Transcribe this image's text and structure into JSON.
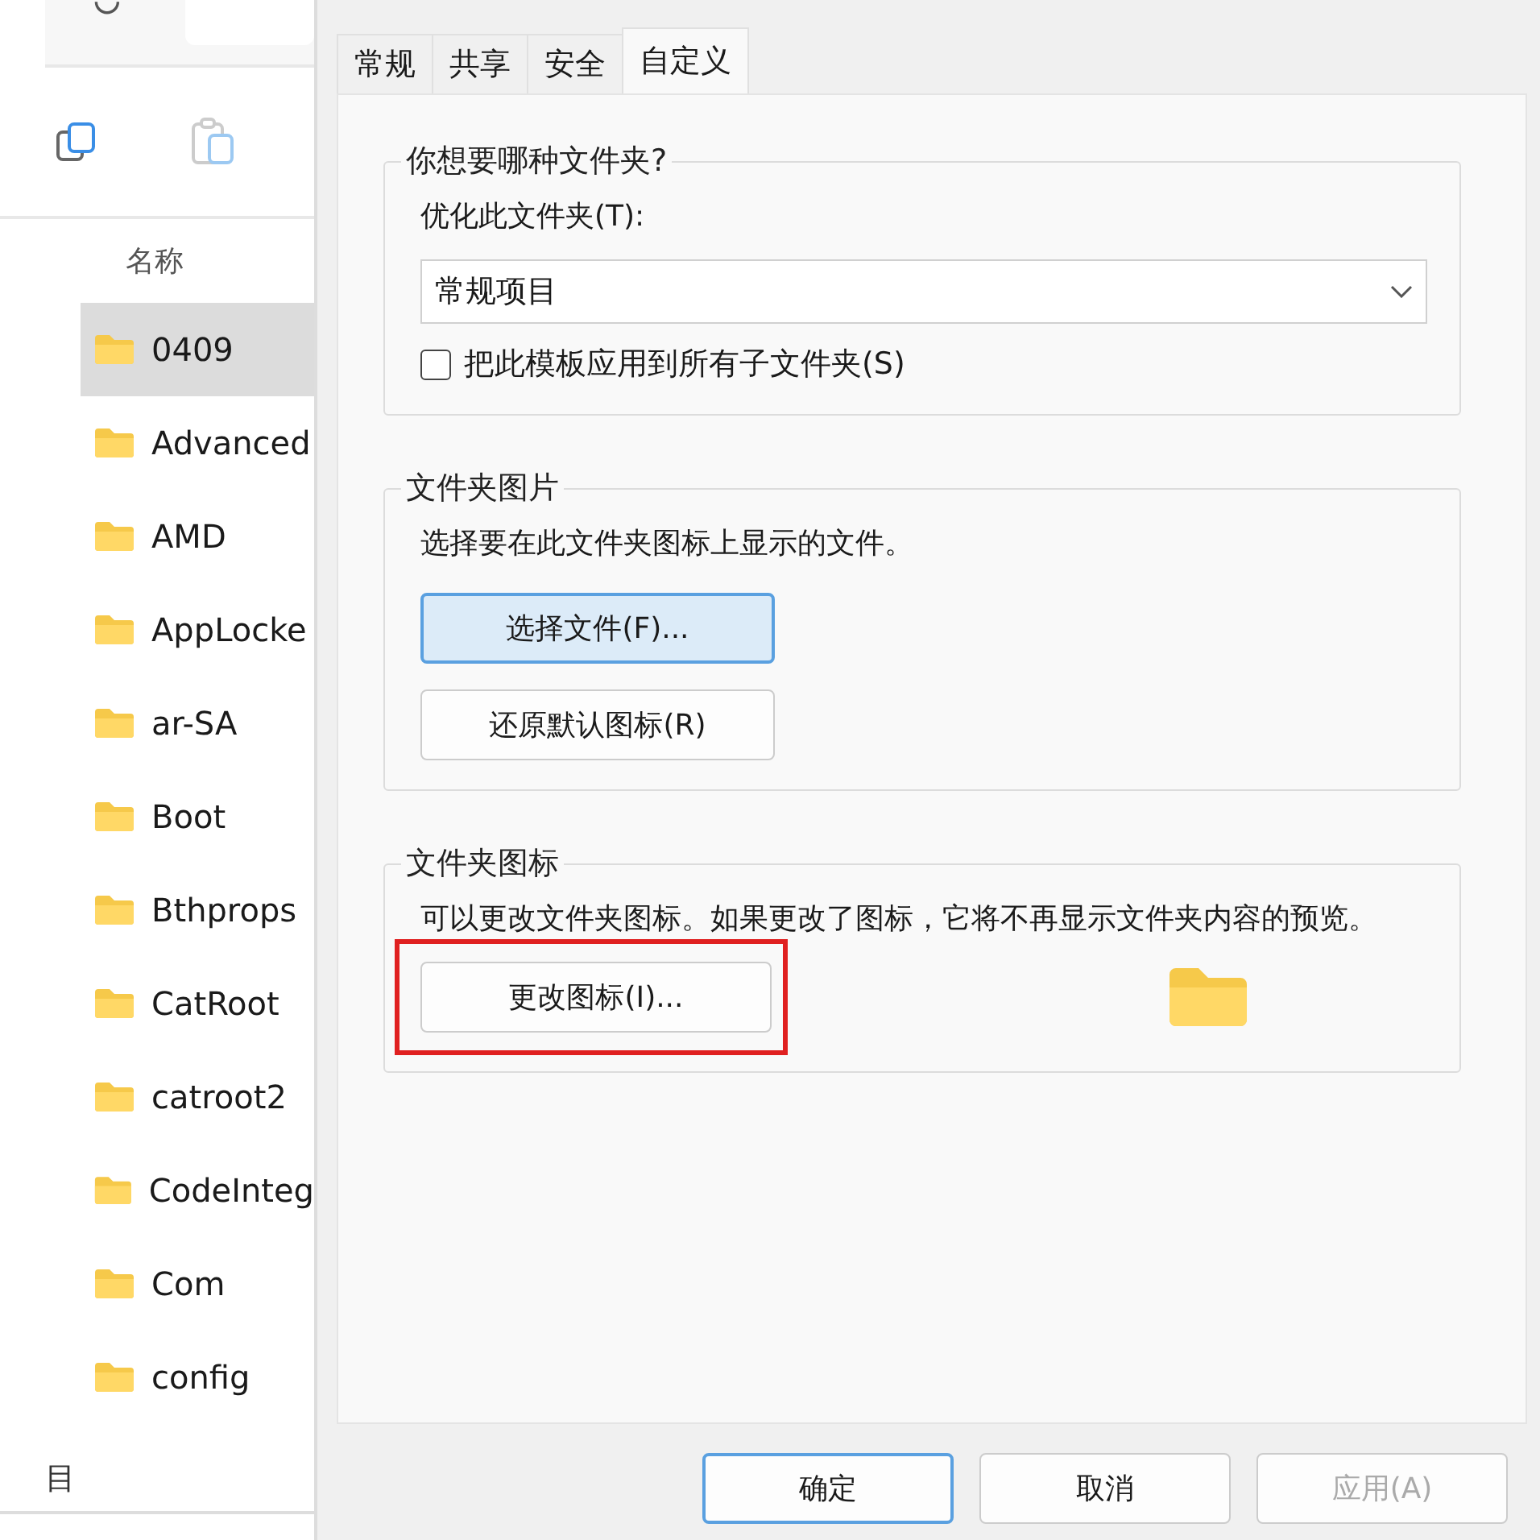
{
  "explorer": {
    "column_header": "名称",
    "items": [
      {
        "name": "0409",
        "selected": true
      },
      {
        "name": "Advanced",
        "selected": false
      },
      {
        "name": "AMD",
        "selected": false
      },
      {
        "name": "AppLocke",
        "selected": false
      },
      {
        "name": "ar-SA",
        "selected": false
      },
      {
        "name": "Boot",
        "selected": false
      },
      {
        "name": "Bthprops",
        "selected": false
      },
      {
        "name": "CatRoot",
        "selected": false
      },
      {
        "name": "catroot2",
        "selected": false
      },
      {
        "name": "CodeInteg",
        "selected": false
      },
      {
        "name": "Com",
        "selected": false
      },
      {
        "name": "config",
        "selected": false
      }
    ],
    "status_text": "目"
  },
  "dialog": {
    "tabs": [
      {
        "label": "常规",
        "selected": false
      },
      {
        "label": "共享",
        "selected": false
      },
      {
        "label": "安全",
        "selected": false
      },
      {
        "label": "自定义",
        "selected": true
      }
    ],
    "folder_type": {
      "title": "你想要哪种文件夹?",
      "label": "优化此文件夹(T):",
      "value": "常规项目",
      "checkbox": {
        "label": "把此模板应用到所有子文件夹(S)",
        "checked": false
      }
    },
    "folder_picture": {
      "title": "文件夹图片",
      "text": "选择要在此文件夹图标上显示的文件。",
      "buttons": [
        {
          "label": "选择文件(F)...",
          "focused": true
        },
        {
          "label": "还原默认图标(R)",
          "focused": false
        }
      ]
    },
    "folder_icon": {
      "title": "文件夹图标",
      "text": "可以更改文件夹图标。如果更改了图标，它将不再显示文件夹内容的预览。",
      "button": {
        "label": "更改图标(I)...",
        "highlighted": true
      }
    },
    "buttons": [
      {
        "label": "确定",
        "kind": "default",
        "disabled": false
      },
      {
        "label": "取消",
        "kind": "normal",
        "disabled": false
      },
      {
        "label": "应用(A)",
        "kind": "normal",
        "disabled": true
      }
    ]
  }
}
